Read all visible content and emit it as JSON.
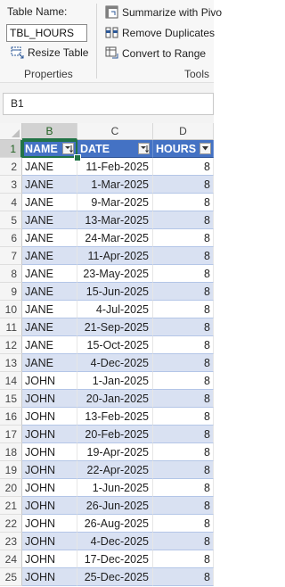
{
  "ribbon": {
    "table_name_label": "Table Name:",
    "table_name_value": "TBL_HOURS",
    "resize_table": "Resize Table",
    "properties_label": "Properties",
    "summarize_pivot": "Summarize with Pivo",
    "remove_duplicates": "Remove Duplicates",
    "convert_to_range": "Convert to Range",
    "tools_label": "Tools",
    "icons": [
      "resize-table-icon",
      "pivot-table-icon",
      "remove-duplicates-icon",
      "convert-to-range-icon"
    ]
  },
  "name_box": "B1",
  "grid": {
    "columns": [
      "B",
      "C",
      "D"
    ],
    "selected_column": "B",
    "selected_row": 1,
    "header_row_number": "1",
    "headers": [
      "NAME",
      "DATE",
      "HOURS"
    ],
    "rows": [
      {
        "num": "2",
        "name": "JANE",
        "date": "11-Feb-2025",
        "hours": "8"
      },
      {
        "num": "3",
        "name": "JANE",
        "date": "1-Mar-2025",
        "hours": "8"
      },
      {
        "num": "4",
        "name": "JANE",
        "date": "9-Mar-2025",
        "hours": "8"
      },
      {
        "num": "5",
        "name": "JANE",
        "date": "13-Mar-2025",
        "hours": "8"
      },
      {
        "num": "6",
        "name": "JANE",
        "date": "24-Mar-2025",
        "hours": "8"
      },
      {
        "num": "7",
        "name": "JANE",
        "date": "11-Apr-2025",
        "hours": "8"
      },
      {
        "num": "8",
        "name": "JANE",
        "date": "23-May-2025",
        "hours": "8"
      },
      {
        "num": "9",
        "name": "JANE",
        "date": "15-Jun-2025",
        "hours": "8"
      },
      {
        "num": "10",
        "name": "JANE",
        "date": "4-Jul-2025",
        "hours": "8"
      },
      {
        "num": "11",
        "name": "JANE",
        "date": "21-Sep-2025",
        "hours": "8"
      },
      {
        "num": "12",
        "name": "JANE",
        "date": "15-Oct-2025",
        "hours": "8"
      },
      {
        "num": "13",
        "name": "JANE",
        "date": "4-Dec-2025",
        "hours": "8"
      },
      {
        "num": "14",
        "name": "JOHN",
        "date": "1-Jan-2025",
        "hours": "8"
      },
      {
        "num": "15",
        "name": "JOHN",
        "date": "20-Jan-2025",
        "hours": "8"
      },
      {
        "num": "16",
        "name": "JOHN",
        "date": "13-Feb-2025",
        "hours": "8"
      },
      {
        "num": "17",
        "name": "JOHN",
        "date": "20-Feb-2025",
        "hours": "8"
      },
      {
        "num": "18",
        "name": "JOHN",
        "date": "19-Apr-2025",
        "hours": "8"
      },
      {
        "num": "19",
        "name": "JOHN",
        "date": "22-Apr-2025",
        "hours": "8"
      },
      {
        "num": "20",
        "name": "JOHN",
        "date": "1-Jun-2025",
        "hours": "8"
      },
      {
        "num": "21",
        "name": "JOHN",
        "date": "26-Jun-2025",
        "hours": "8"
      },
      {
        "num": "22",
        "name": "JOHN",
        "date": "26-Aug-2025",
        "hours": "8"
      },
      {
        "num": "23",
        "name": "JOHN",
        "date": "4-Dec-2025",
        "hours": "8"
      },
      {
        "num": "24",
        "name": "JOHN",
        "date": "17-Dec-2025",
        "hours": "8"
      },
      {
        "num": "25",
        "name": "JOHN",
        "date": "25-Dec-2025",
        "hours": "8"
      }
    ]
  },
  "colors": {
    "table_header": "#4472c4",
    "band_row": "#d9e1f2",
    "selection": "#217346"
  }
}
